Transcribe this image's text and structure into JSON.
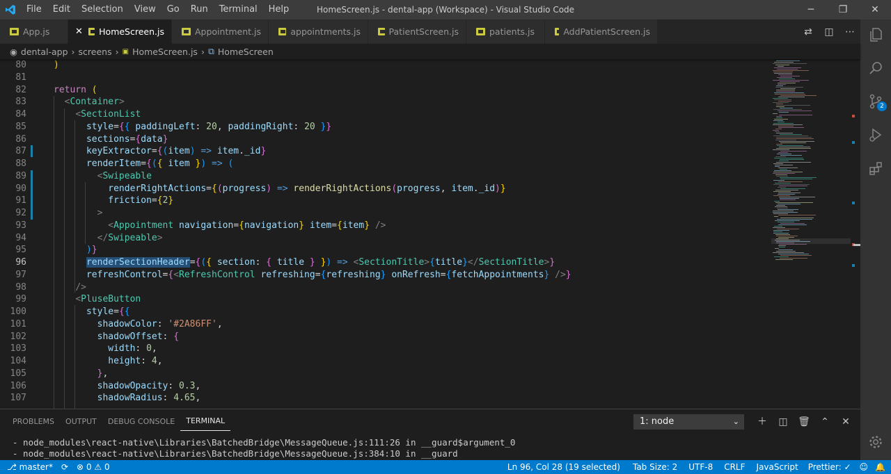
{
  "window": {
    "title": "HomeScreen.js - dental-app (Workspace) - Visual Studio Code",
    "menu": [
      "File",
      "Edit",
      "Selection",
      "View",
      "Go",
      "Run",
      "Terminal",
      "Help"
    ]
  },
  "tabs": [
    {
      "label": "App.js",
      "active": false
    },
    {
      "label": "HomeScreen.js",
      "active": true
    },
    {
      "label": "Appointment.js",
      "active": false
    },
    {
      "label": "appointments.js",
      "active": false
    },
    {
      "label": "PatientScreen.js",
      "active": false
    },
    {
      "label": "patients.js",
      "active": false
    },
    {
      "label": "AddPatientScreen.js",
      "active": false
    }
  ],
  "breadcrumb": {
    "workspace": "dental-app",
    "folder": "screens",
    "file": "HomeScreen.js",
    "symbol": "HomeScreen"
  },
  "editor": {
    "line_numbers": [
      "80",
      "81",
      "82",
      "83",
      "84",
      "85",
      "86",
      "87",
      "88",
      "89",
      "90",
      "91",
      "92",
      "93",
      "94",
      "95",
      "96",
      "97",
      "98",
      "99",
      "100",
      "101",
      "102",
      "103",
      "104",
      "105",
      "106",
      "107"
    ]
  },
  "panel": {
    "tabs": [
      "PROBLEMS",
      "OUTPUT",
      "DEBUG CONSOLE",
      "TERMINAL"
    ],
    "active_tab": "TERMINAL",
    "terminal_select": "1: node",
    "lines": [
      "- node_modules\\react-native\\Libraries\\BatchedBridge\\MessageQueue.js:111:26 in __guard$argument_0",
      "- node_modules\\react-native\\Libraries\\BatchedBridge\\MessageQueue.js:384:10 in __guard"
    ]
  },
  "statusbar": {
    "branch": "master*",
    "errors": "0",
    "warnings": "0",
    "cursor": "Ln 96, Col 28 (19 selected)",
    "tab_size": "Tab Size: 2",
    "encoding": "UTF-8",
    "eol": "CRLF",
    "language": "JavaScript",
    "formatter": "Prettier: ✓"
  },
  "activity": {
    "scm_badge": "2"
  },
  "colors": {
    "accent": "#007acc",
    "titlebar": "#3c3c3c",
    "editor_bg": "#1e1e1e"
  }
}
